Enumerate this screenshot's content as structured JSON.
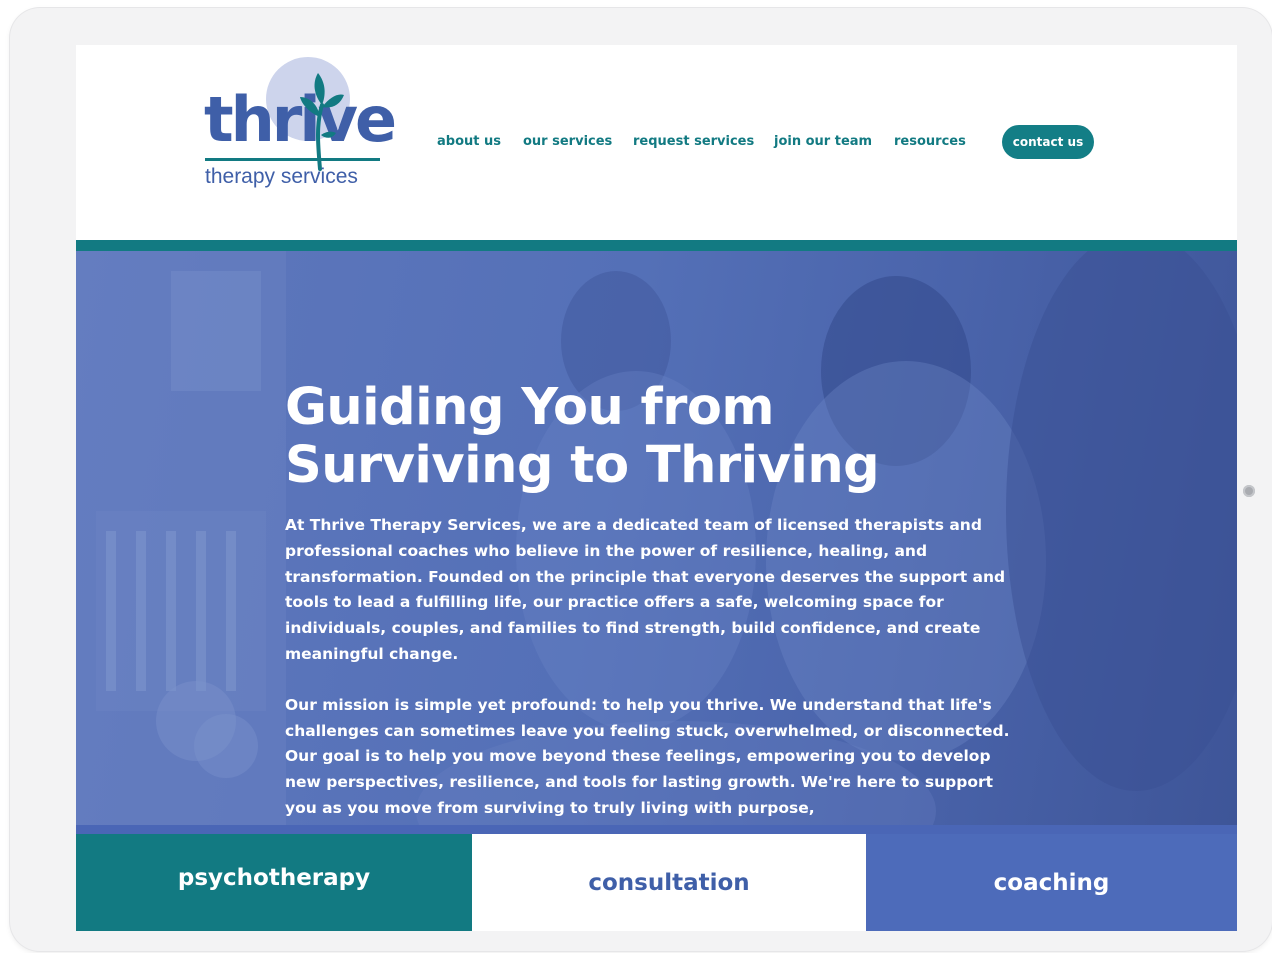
{
  "logo": {
    "word": "thrive",
    "subtitle": "therapy services"
  },
  "nav": {
    "items": [
      {
        "label": "about us"
      },
      {
        "label": "our services"
      },
      {
        "label": "request services"
      },
      {
        "label": "join our team"
      },
      {
        "label": "resources"
      }
    ],
    "contact_label": "contact us"
  },
  "hero": {
    "title": "Guiding You from\nSurviving to Thriving",
    "paragraphs": [
      "At Thrive Therapy Services, we are a dedicated team of licensed therapists and professional coaches who believe in the power of resilience, healing, and transformation.  Founded on the principle that everyone deserves the support and tools to lead a fulfilling life, our practice offers a safe, welcoming space for individuals, couples, and families to find strength, build confidence, and create meaningful change.",
      "Our mission is simple yet profound: to help you thrive.  We understand that life's challenges can sometimes leave you feeling stuck, overwhelmed, or disconnected.  Our goal is to help you move beyond these feelings, empowering you to develop new perspectives, resilience, and tools for lasting growth.  We're here to support you as you move from surviving to truly living with purpose,"
    ]
  },
  "tiles": [
    {
      "label": "psychotherapy"
    },
    {
      "label": "consultation"
    },
    {
      "label": "coaching"
    }
  ],
  "colors": {
    "teal": "#127a82",
    "brand_blue": "#3f5fa8",
    "hero_blue": "#5470b7",
    "coaching_blue": "#4d6bba"
  }
}
